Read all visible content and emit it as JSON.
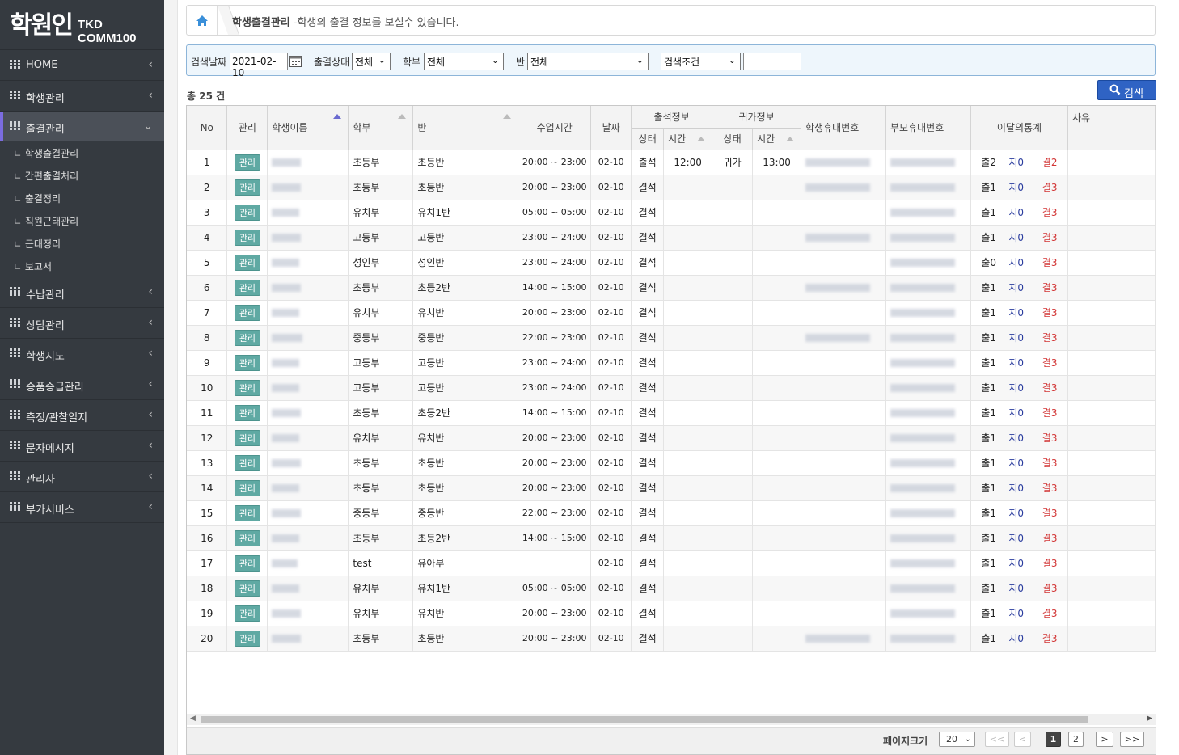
{
  "brand": {
    "logo_text": "학원인",
    "logo_sub": "TKD COMM100"
  },
  "sidebar": {
    "items": [
      {
        "label": "HOME"
      },
      {
        "label": "학생관리"
      },
      {
        "label": "출결관리"
      },
      {
        "label": "수납관리"
      },
      {
        "label": "상담관리"
      },
      {
        "label": "학생지도"
      },
      {
        "label": "승품승급관리"
      },
      {
        "label": "측정/관찰일지"
      },
      {
        "label": "문자메시지"
      },
      {
        "label": "관리자"
      },
      {
        "label": "부가서비스"
      }
    ],
    "subitems": [
      {
        "label": "학생출결관리"
      },
      {
        "label": "간편출결처리"
      },
      {
        "label": "출결정리"
      },
      {
        "label": "직원근태관리"
      },
      {
        "label": "근태정리"
      },
      {
        "label": "보고서"
      }
    ],
    "sub_prefix": "ㄴ",
    "arrow": "‹",
    "arrow_open": "⌄"
  },
  "breadcrumb": {
    "title": "학생출결관리",
    "desc": " -학생의 출결 정보를 보실수 있습니다."
  },
  "filters": {
    "date_label": "검색날짜",
    "date_value": "2021-02-10",
    "status_label": "출결상태",
    "status_value": "전체",
    "dept_label": "학부",
    "dept_value": "전체",
    "class_label": "반",
    "class_value": "전체",
    "cond_value": "검색조건",
    "keyword_value": ""
  },
  "count": {
    "prefix": "총",
    "num": "25",
    "suffix": "건"
  },
  "search_button": "검색",
  "table": {
    "headers": {
      "no": "No",
      "manage": "관리",
      "name": "학생이름",
      "dept": "학부",
      "class": "반",
      "time": "수업시간",
      "date": "날짜",
      "att": "출석정보",
      "home": "귀가정보",
      "phone": "학생휴대번호",
      "pphone": "부모휴대번호",
      "stat": "이달의통계",
      "reason": "사유",
      "state": "상태",
      "t": "시간"
    },
    "manage_label": "관리",
    "rows": [
      {
        "no": "1",
        "dept": "초등부",
        "cls": "초등반",
        "time": "20:00 ~ 23:00",
        "date": "02-10",
        "att": "출석",
        "att_time": "12:00",
        "home": "귀가",
        "home_time": "13:00",
        "sphone": true,
        "s1": "출2",
        "s2": "지0",
        "s3": "결2"
      },
      {
        "no": "2",
        "dept": "초등부",
        "cls": "초등반",
        "time": "20:00 ~ 23:00",
        "date": "02-10",
        "att": "결석",
        "att_time": "",
        "home": "",
        "home_time": "",
        "sphone": true,
        "s1": "출1",
        "s2": "지0",
        "s3": "결3"
      },
      {
        "no": "3",
        "dept": "유치부",
        "cls": "유치1반",
        "time": "05:00 ~ 05:00",
        "date": "02-10",
        "att": "결석",
        "att_time": "",
        "home": "",
        "home_time": "",
        "sphone": false,
        "s1": "출1",
        "s2": "지0",
        "s3": "결3"
      },
      {
        "no": "4",
        "dept": "고등부",
        "cls": "고등반",
        "time": "23:00 ~ 24:00",
        "date": "02-10",
        "att": "결석",
        "att_time": "",
        "home": "",
        "home_time": "",
        "sphone": true,
        "s1": "출1",
        "s2": "지0",
        "s3": "결3"
      },
      {
        "no": "5",
        "dept": "성인부",
        "cls": "성인반",
        "time": "23:00 ~ 24:00",
        "date": "02-10",
        "att": "결석",
        "att_time": "",
        "home": "",
        "home_time": "",
        "sphone": false,
        "s1": "출0",
        "s2": "지0",
        "s3": "결3"
      },
      {
        "no": "6",
        "dept": "초등부",
        "cls": "초등2반",
        "time": "14:00 ~ 15:00",
        "date": "02-10",
        "att": "결석",
        "att_time": "",
        "home": "",
        "home_time": "",
        "sphone": true,
        "s1": "출1",
        "s2": "지0",
        "s3": "결3"
      },
      {
        "no": "7",
        "dept": "유치부",
        "cls": "유치반",
        "time": "20:00 ~ 23:00",
        "date": "02-10",
        "att": "결석",
        "att_time": "",
        "home": "",
        "home_time": "",
        "sphone": false,
        "s1": "출1",
        "s2": "지0",
        "s3": "결3"
      },
      {
        "no": "8",
        "dept": "중등부",
        "cls": "중등반",
        "time": "22:00 ~ 23:00",
        "date": "02-10",
        "att": "결석",
        "att_time": "",
        "home": "",
        "home_time": "",
        "sphone": true,
        "s1": "출1",
        "s2": "지0",
        "s3": "결3"
      },
      {
        "no": "9",
        "dept": "고등부",
        "cls": "고등반",
        "time": "23:00 ~ 24:00",
        "date": "02-10",
        "att": "결석",
        "att_time": "",
        "home": "",
        "home_time": "",
        "sphone": false,
        "s1": "출1",
        "s2": "지0",
        "s3": "결3"
      },
      {
        "no": "10",
        "dept": "고등부",
        "cls": "고등반",
        "time": "23:00 ~ 24:00",
        "date": "02-10",
        "att": "결석",
        "att_time": "",
        "home": "",
        "home_time": "",
        "sphone": false,
        "s1": "출1",
        "s2": "지0",
        "s3": "결3"
      },
      {
        "no": "11",
        "dept": "초등부",
        "cls": "초등2반",
        "time": "14:00 ~ 15:00",
        "date": "02-10",
        "att": "결석",
        "att_time": "",
        "home": "",
        "home_time": "",
        "sphone": false,
        "s1": "출1",
        "s2": "지0",
        "s3": "결3"
      },
      {
        "no": "12",
        "dept": "유치부",
        "cls": "유치반",
        "time": "20:00 ~ 23:00",
        "date": "02-10",
        "att": "결석",
        "att_time": "",
        "home": "",
        "home_time": "",
        "sphone": false,
        "s1": "출1",
        "s2": "지0",
        "s3": "결3"
      },
      {
        "no": "13",
        "dept": "초등부",
        "cls": "초등반",
        "time": "20:00 ~ 23:00",
        "date": "02-10",
        "att": "결석",
        "att_time": "",
        "home": "",
        "home_time": "",
        "sphone": false,
        "s1": "출1",
        "s2": "지0",
        "s3": "결3"
      },
      {
        "no": "14",
        "dept": "초등부",
        "cls": "초등반",
        "time": "20:00 ~ 23:00",
        "date": "02-10",
        "att": "결석",
        "att_time": "",
        "home": "",
        "home_time": "",
        "sphone": false,
        "s1": "출1",
        "s2": "지0",
        "s3": "결3"
      },
      {
        "no": "15",
        "dept": "중등부",
        "cls": "중등반",
        "time": "22:00 ~ 23:00",
        "date": "02-10",
        "att": "결석",
        "att_time": "",
        "home": "",
        "home_time": "",
        "sphone": false,
        "s1": "출1",
        "s2": "지0",
        "s3": "결3"
      },
      {
        "no": "16",
        "dept": "초등부",
        "cls": "초등2반",
        "time": "14:00 ~ 15:00",
        "date": "02-10",
        "att": "결석",
        "att_time": "",
        "home": "",
        "home_time": "",
        "sphone": false,
        "s1": "출1",
        "s2": "지0",
        "s3": "결3"
      },
      {
        "no": "17",
        "dept": "test",
        "cls": "유아부",
        "time": "",
        "date": "02-10",
        "att": "결석",
        "att_time": "",
        "home": "",
        "home_time": "",
        "sphone": false,
        "s1": "출1",
        "s2": "지0",
        "s3": "결3"
      },
      {
        "no": "18",
        "dept": "유치부",
        "cls": "유치1반",
        "time": "05:00 ~ 05:00",
        "date": "02-10",
        "att": "결석",
        "att_time": "",
        "home": "",
        "home_time": "",
        "sphone": false,
        "s1": "출1",
        "s2": "지0",
        "s3": "결3"
      },
      {
        "no": "19",
        "dept": "유치부",
        "cls": "유치반",
        "time": "20:00 ~ 23:00",
        "date": "02-10",
        "att": "결석",
        "att_time": "",
        "home": "",
        "home_time": "",
        "sphone": false,
        "s1": "출1",
        "s2": "지0",
        "s3": "결3"
      },
      {
        "no": "20",
        "dept": "초등부",
        "cls": "초등반",
        "time": "20:00 ~ 23:00",
        "date": "02-10",
        "att": "결석",
        "att_time": "",
        "home": "",
        "home_time": "",
        "sphone": true,
        "s1": "출1",
        "s2": "지0",
        "s3": "결3"
      }
    ]
  },
  "pager": {
    "size_label": "페이지크기",
    "size_value": "20",
    "first": "<<",
    "prev": "<",
    "pages": [
      "1",
      "2"
    ],
    "next": ">",
    "last": ">>"
  },
  "colors": {
    "sidebar": "#353a40",
    "active_bar": "#7b6ce0",
    "search_btn": "#2f63c4",
    "manage_btn": "#5fa9a3",
    "stat_late": "#2a3c9e",
    "stat_absent": "#d23535"
  }
}
